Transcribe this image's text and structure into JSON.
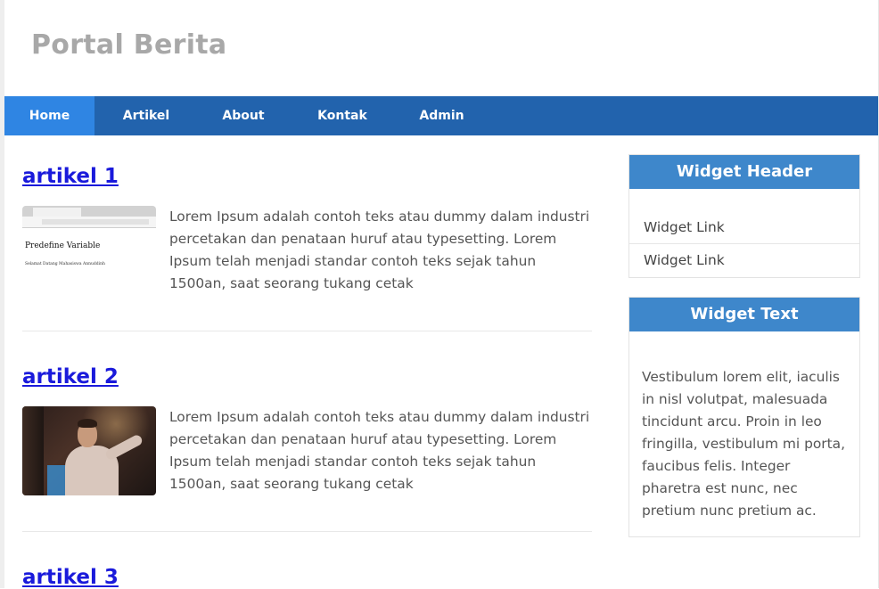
{
  "site": {
    "title": "Portal Berita"
  },
  "nav": {
    "items": [
      {
        "label": "Home",
        "active": true
      },
      {
        "label": "Artikel"
      },
      {
        "label": "About"
      },
      {
        "label": "Kontak"
      },
      {
        "label": "Admin"
      }
    ]
  },
  "articles": [
    {
      "title": "artikel 1",
      "excerpt": "Lorem Ipsum adalah contoh teks atau dummy dalam industri percetakan dan penataan huruf atau typesetting. Lorem Ipsum telah menjadi standar contoh teks sejak tahun 1500an, saat seorang tukang cetak",
      "thumb": {
        "heading": "Predefine Variable",
        "text": "Selamat Datang Mahasiswa Annuddinh"
      }
    },
    {
      "title": "artikel 2",
      "excerpt": "Lorem Ipsum adalah contoh teks atau dummy dalam industri percetakan dan penataan huruf atau typesetting. Lorem Ipsum telah menjadi standar contoh teks sejak tahun 1500an, saat seorang tukang cetak"
    },
    {
      "title": "artikel 3"
    }
  ],
  "sidebar": {
    "widget1": {
      "header": "Widget Header",
      "links": [
        "Widget Link",
        "Widget Link"
      ]
    },
    "widget2": {
      "header": "Widget Text",
      "text": "Vestibulum lorem elit, iaculis in nisl volutpat, malesuada tincidunt arcu. Proin in leo fringilla, vestibulum mi porta, faucibus felis. Integer pharetra est nunc, nec pretium nunc pretium ac."
    }
  },
  "colors": {
    "nav_bg": "#2263ad",
    "nav_active": "#2f85e3",
    "widget_header": "#3e87cb",
    "link": "#1a1adb",
    "site_title": "#a8a8a8"
  }
}
